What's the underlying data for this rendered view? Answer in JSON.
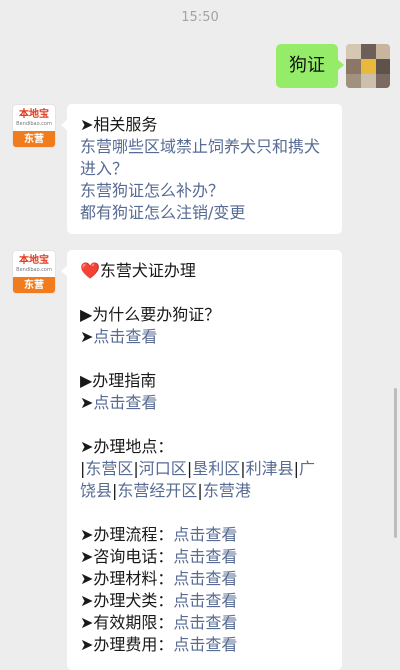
{
  "status": {
    "time": "15:50"
  },
  "outgoing": {
    "text": "狗证"
  },
  "bot": {
    "brand": "本地宝",
    "site": "Bendibao.com",
    "city": "东营"
  },
  "msg1": {
    "heading": "➤相关服务",
    "links": [
      "东营哪些区域禁止饲养犬只和携犬进入？",
      "东营狗证怎么补办？",
      "都有狗证怎么注销/变更"
    ]
  },
  "msg2": {
    "heart": "❤️",
    "title": "东营犬证办理",
    "why_heading": "▶为什么要办狗证？",
    "guide_heading": "▶办理指南",
    "arrow": "➤",
    "view_link": "点击查看",
    "location_heading": "➤办理地点：",
    "districts": [
      "东营区",
      "河口区",
      "垦利区",
      "利津县",
      "广饶县",
      "东营经开区",
      "东营港"
    ],
    "items": [
      {
        "label": "➤办理流程：",
        "link": "点击查看"
      },
      {
        "label": "➤咨询电话：",
        "link": "点击查看"
      },
      {
        "label": "➤办理材料：",
        "link": "点击查看"
      },
      {
        "label": "➤办理犬类：",
        "link": "点击查看"
      },
      {
        "label": "➤有效期限：",
        "link": "点击查看"
      },
      {
        "label": "➤办理费用：",
        "link": "点击查看"
      }
    ]
  }
}
